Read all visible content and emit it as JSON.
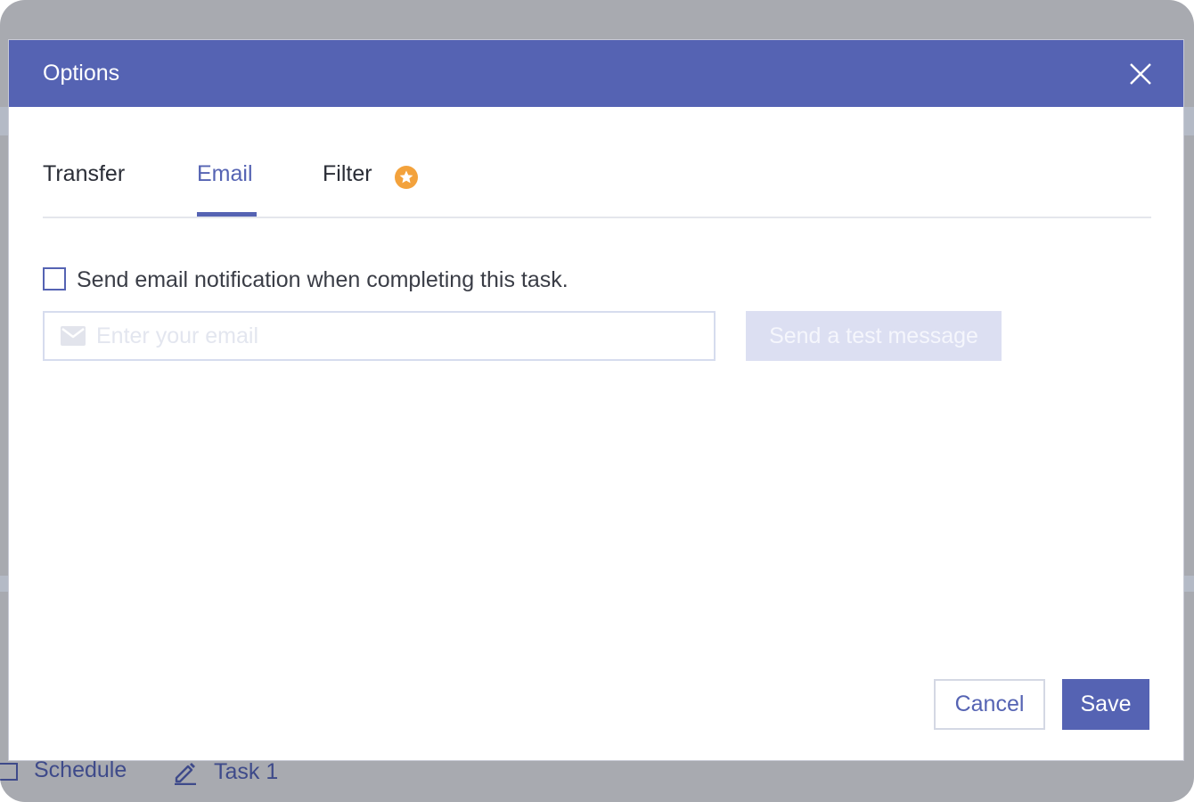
{
  "dialog": {
    "title": "Options",
    "close_icon": "close-icon"
  },
  "tabs": [
    {
      "label": "Transfer",
      "active": false
    },
    {
      "label": "Email",
      "active": true
    },
    {
      "label": "Filter",
      "active": false,
      "badge_icon": "star-badge-icon"
    }
  ],
  "email": {
    "checkbox_label": "Send email notification when completing this task.",
    "checkbox_checked": false,
    "input_placeholder": "Enter your email",
    "input_value": "",
    "input_icon": "mail-icon",
    "test_button_label": "Send a test message",
    "test_button_enabled": false
  },
  "footer": {
    "cancel_label": "Cancel",
    "save_label": "Save"
  },
  "background": {
    "schedule_label": "Schedule",
    "task_label": "Task 1"
  },
  "colors": {
    "accent": "#5563b3",
    "star_badge": "#f3a23c",
    "overlay": "#a8aab0"
  }
}
